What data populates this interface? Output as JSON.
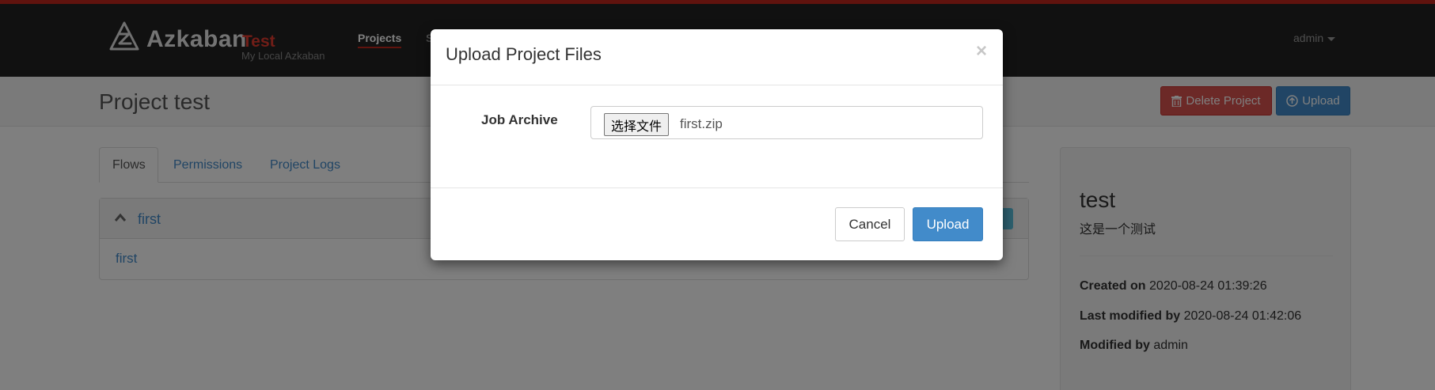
{
  "navbar": {
    "brand": "Azkaban",
    "environment": "Test",
    "subtitle": "My Local Azkaban",
    "items": [
      {
        "label": "Projects",
        "active": true
      },
      {
        "label": "S"
      }
    ],
    "user": "admin",
    "accent_color": "#c0271d"
  },
  "header": {
    "title": "Project test",
    "delete_label": "Delete Project",
    "upload_label": "Upload"
  },
  "tabs": [
    {
      "label": "Flows",
      "active": true
    },
    {
      "label": "Permissions"
    },
    {
      "label": "Project Logs"
    }
  ],
  "flows": {
    "panel_title": "first",
    "items": [
      "first"
    ]
  },
  "project_info": {
    "name": "test",
    "description": "这是一个测试",
    "created_on_label": "Created on",
    "created_on": "2020-08-24 01:39:26",
    "last_modified_label": "Last modified by",
    "last_modified": "2020-08-24 01:42:06",
    "modified_by_label": "Modified by",
    "modified_by": "admin"
  },
  "modal": {
    "title": "Upload Project Files",
    "close": "×",
    "field_label": "Job Archive",
    "file_button": "选择文件",
    "file_name": "first.zip",
    "cancel_label": "Cancel",
    "upload_label": "Upload"
  },
  "icons": {
    "logo": "azkaban-logo-icon",
    "delete": "trash-icon",
    "upload": "upload-circle-icon",
    "collapse": "chevron-up-icon",
    "dropdown": "caret-down-icon"
  }
}
